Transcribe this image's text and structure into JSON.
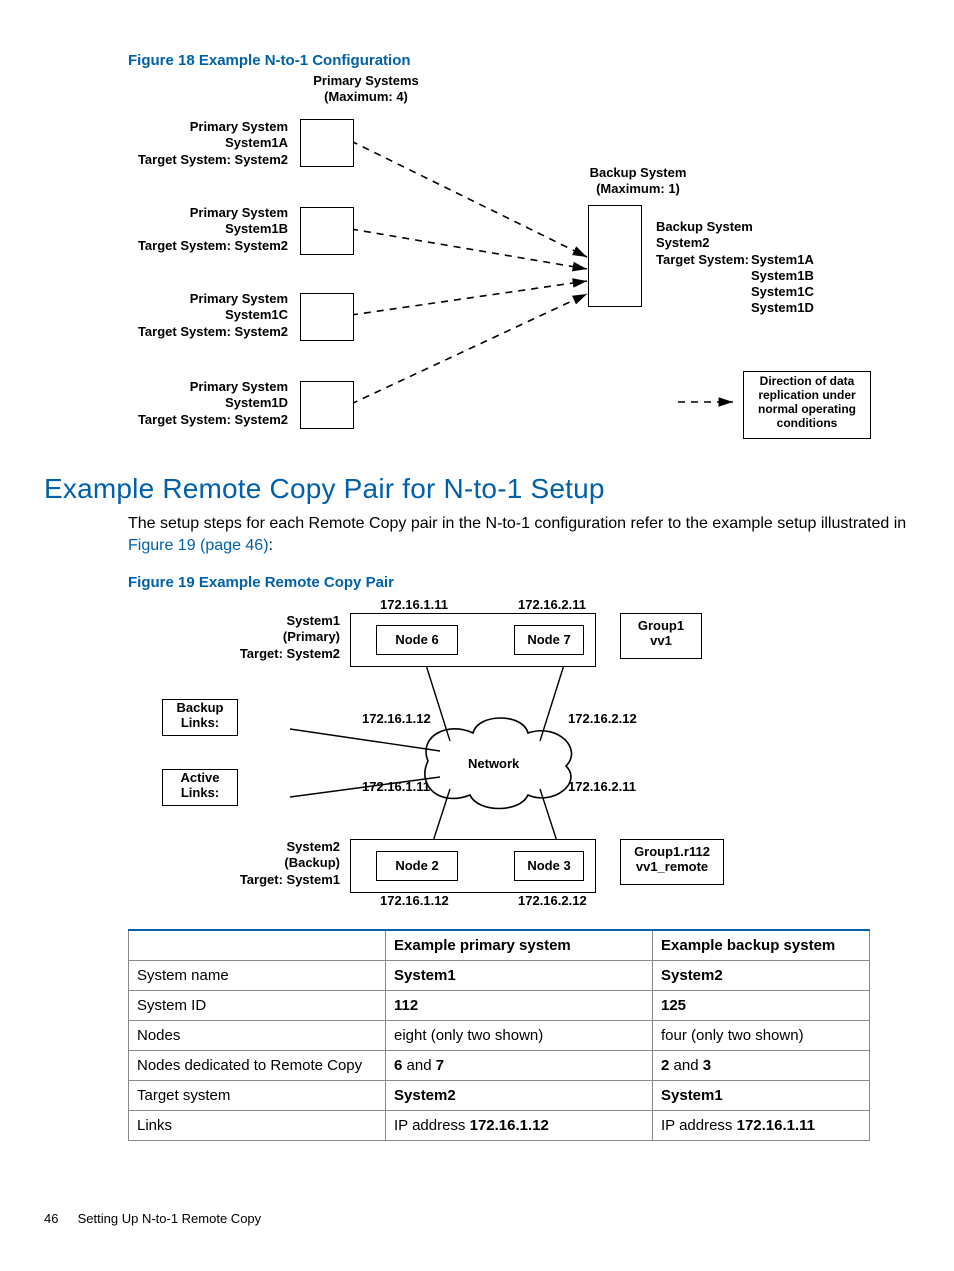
{
  "fig18": {
    "title": "Figure 18 Example N-to-1 Configuration",
    "primary_heading": "Primary Systems",
    "primary_max": "(Maximum: 4)",
    "backup_heading": "Backup System",
    "backup_max": "(Maximum: 1)",
    "systems": [
      {
        "t1": "Primary System",
        "t2": "System1A",
        "t3": "Target System: System2"
      },
      {
        "t1": "Primary System",
        "t2": "System1B",
        "t3": "Target System: System2"
      },
      {
        "t1": "Primary System",
        "t2": "System1C",
        "t3": "Target System: System2"
      },
      {
        "t1": "Primary System",
        "t2": "System1D",
        "t3": "Target System: System2"
      }
    ],
    "backup": {
      "t1": "Backup System",
      "t2": "System2",
      "t3": "Target System:",
      "targets": [
        "System1A",
        "System1B",
        "System1C",
        "System1D"
      ]
    },
    "legend": [
      "Direction of data",
      "replication under",
      "normal operating",
      "conditions"
    ]
  },
  "section": {
    "title": "Example Remote Copy Pair for N-to-1 Setup",
    "body_a": "The setup steps for each Remote Copy pair in the N-to-1 configuration refer to the example setup illustrated in ",
    "link": "Figure 19 (page 46)",
    "body_b": ":"
  },
  "fig19": {
    "title": "Figure 19 Example Remote Copy Pair",
    "sys1": {
      "l1": "System1",
      "l2": "(Primary)",
      "l3": "Target: System2"
    },
    "sys2": {
      "l1": "System2",
      "l2": "(Backup)",
      "l3": "Target: System1"
    },
    "node6": "Node 6",
    "node7": "Node 7",
    "node2": "Node 2",
    "node3": "Node 3",
    "ip_n6_t": "172.16.1.11",
    "ip_n7_t": "172.16.2.11",
    "ip_n6_b": "172.16.1.12",
    "ip_n7_b": "172.16.2.12",
    "ip_mid_l": "172.16.1.11",
    "ip_mid_r": "172.16.2.11",
    "ip_n2_b": "172.16.1.12",
    "ip_n3_b": "172.16.2.12",
    "group1": {
      "l1": "Group1",
      "l2": "vv1"
    },
    "group2": {
      "l1": "Group1.r112",
      "l2": "vv1_remote"
    },
    "backup_links": "Backup Links:",
    "active_links": "Active Links:",
    "network": "Network"
  },
  "table": {
    "headers": [
      "",
      "Example primary system",
      "Example backup system"
    ],
    "rows": [
      {
        "label": "System name",
        "p": "System1",
        "pbold": true,
        "b": "System2",
        "bbold": true
      },
      {
        "label": "System ID",
        "p": "112",
        "pbold": true,
        "b": "125",
        "bbold": true
      },
      {
        "label": "Nodes",
        "p": "eight (only two shown)",
        "pbold": false,
        "b": "four (only two shown)",
        "bbold": false
      },
      {
        "label": "Nodes dedicated to Remote Copy",
        "p_prefix": "",
        "p": "6",
        "p_mid": " and ",
        "p2": "7",
        "b": "2",
        "b_mid": " and ",
        "b2": "3"
      },
      {
        "label": "Target system",
        "p": "System2",
        "pbold": true,
        "b": "System1",
        "bbold": true
      },
      {
        "label": "Links",
        "p_prefix": "IP address ",
        "p": "172.16.1.12",
        "pbold": true,
        "b_prefix": "IP address ",
        "b": "172.16.1.11",
        "bbold": true
      }
    ]
  },
  "footer": {
    "page": "46",
    "text": "Setting Up N-to-1 Remote Copy"
  }
}
